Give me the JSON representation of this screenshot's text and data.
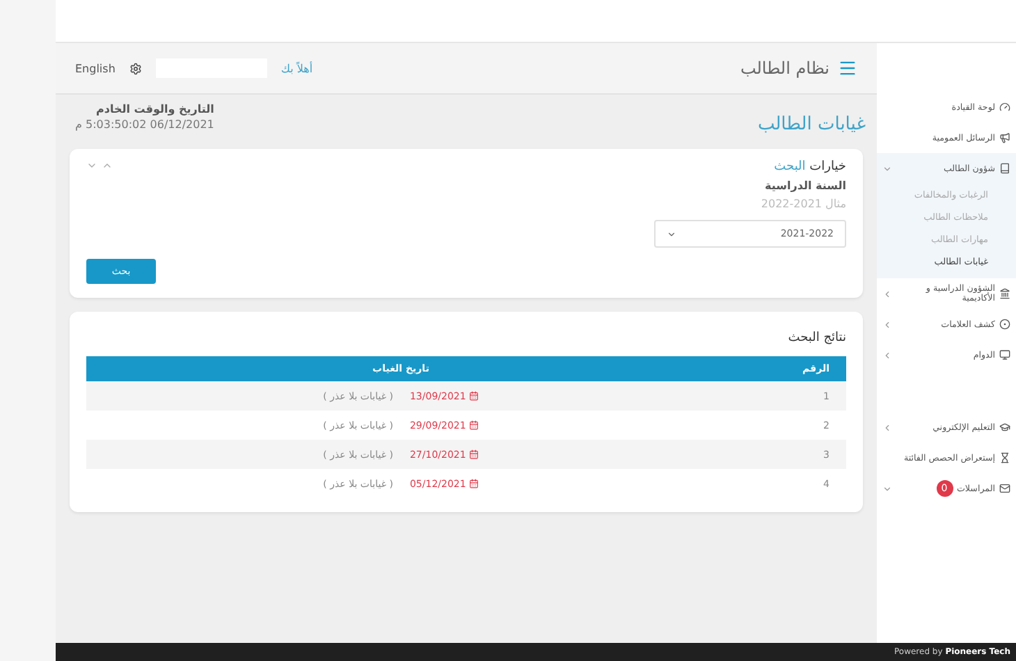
{
  "header": {
    "title": "نظام الطالب",
    "greeting": "أهلاً بك",
    "language": "English"
  },
  "page": {
    "title": "غيابات الطالب",
    "server_time_label": "التاريخ والوقت الخادم",
    "server_time": "06/12/2021 5:03:50:02 م"
  },
  "search_options": {
    "title": "خيارات",
    "title_accent": "البحث",
    "field": {
      "label": "السنة الدراسية",
      "hint": "مثال 2021-2022",
      "value": "2021-2022"
    },
    "button": "بحث"
  },
  "results": {
    "title": "نتائج البحث",
    "columns": [
      "الرقم",
      "تاريخ الغياب"
    ],
    "rows": [
      {
        "number": "1",
        "date": "13/09/2021",
        "type": "( غيابات بلا عذر )"
      },
      {
        "number": "2",
        "date": "29/09/2021",
        "type": "( غيابات بلا عذر )"
      },
      {
        "number": "3",
        "date": "27/10/2021",
        "type": "( غيابات بلا عذر )"
      },
      {
        "number": "4",
        "date": "05/12/2021",
        "type": "( غيابات بلا عذر )"
      }
    ]
  },
  "sidebar": {
    "sections": [
      {
        "items": [
          {
            "label": "لوحة القيادة"
          },
          {
            "label": "الرسائل العمومية"
          },
          {
            "label": "شؤون الطالب",
            "expandable": true,
            "expanded": true,
            "children": [
              {
                "label": "الرغبات والمخالفات",
                "selected": false
              },
              {
                "label": "ملاحظات الطالب",
                "selected": false
              },
              {
                "label": "مهارات الطالب",
                "selected": false
              },
              {
                "label": "غيابات الطالب",
                "selected": true
              }
            ]
          },
          {
            "label": "الشؤون الدراسية و الأكاديمية",
            "expandable": true,
            "expanded": false
          },
          {
            "label": "كشف العلامات",
            "expandable": true,
            "expanded": false
          },
          {
            "label": "الدوام",
            "expandable": true,
            "expanded": false
          }
        ]
      },
      {
        "items": [
          {
            "label": "التعليم الإلكتروني",
            "expandable": true,
            "expanded": false
          },
          {
            "label": "إستعراض الحصص الفائتة"
          },
          {
            "label": "المراسلات",
            "expandable": true,
            "expanded": true,
            "badge": "0"
          }
        ]
      }
    ]
  },
  "footer": {
    "text": "Powered by **Pioneers Tech**"
  }
}
